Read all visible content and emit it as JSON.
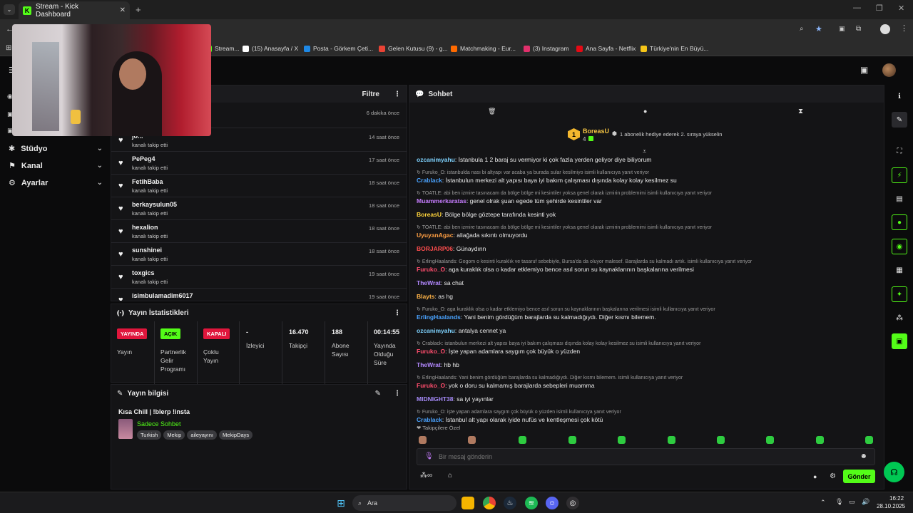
{
  "browser": {
    "tab_title": "Stream - Kick Dashboard",
    "new_tab": "+",
    "bookmarks": [
      {
        "label": "Stream...",
        "color": "#53fc18"
      },
      {
        "label": "(15) Anasayfa / X",
        "color": "#ffffff"
      },
      {
        "label": "Posta - Görkem Çeti...",
        "color": "#1e88e5"
      },
      {
        "label": "Gelen Kutusu (9) - g...",
        "color": "#ea4335"
      },
      {
        "label": "Matchmaking - Eur...",
        "color": "#ff6a00"
      },
      {
        "label": "(3) Instagram",
        "color": "#e1306c"
      },
      {
        "label": "Ana Sayfa - Netflix",
        "color": "#e50914"
      },
      {
        "label": "Türkiye'nin En Büyü...",
        "color": "#f5c518"
      }
    ]
  },
  "sidebar": {
    "items": [
      {
        "label": "Stüdyo",
        "icon": "studio-icon"
      },
      {
        "label": "Kanal",
        "icon": "channel-icon"
      },
      {
        "label": "Ayarlar",
        "icon": "gear-icon"
      }
    ]
  },
  "activity": {
    "filter_label": "Filtre",
    "first_time": "6 dakika önce",
    "rows": [
      {
        "name": "jo...",
        "sub": "kanalı takip etti",
        "time": "14 saat önce"
      },
      {
        "name": "PePeg4",
        "sub": "kanalı takip etti",
        "time": "17 saat önce"
      },
      {
        "name": "FetihBaba",
        "sub": "kanalı takip etti",
        "time": "18 saat önce"
      },
      {
        "name": "berkaysulun05",
        "sub": "kanalı takip etti",
        "time": "18 saat önce"
      },
      {
        "name": "hexalion",
        "sub": "kanalı takip etti",
        "time": "18 saat önce"
      },
      {
        "name": "sunshinei",
        "sub": "kanalı takip etti",
        "time": "18 saat önce"
      },
      {
        "name": "toxgics",
        "sub": "kanalı takip etti",
        "time": "19 saat önce"
      },
      {
        "name": "isimbulamadim6017",
        "sub": "",
        "time": "19 saat önce"
      }
    ]
  },
  "stats": {
    "title": "Yayın İstatistikleri",
    "cols": [
      {
        "badge": "YAYINDA",
        "badge_color": "#e0163c",
        "label": "Yayın"
      },
      {
        "badge": "AÇIK",
        "badge_color": "#53fc18",
        "label": "Partnerlik Gelir Programı"
      },
      {
        "badge": "KAPALI",
        "badge_color": "#e0163c",
        "label": "Çoklu Yayın"
      },
      {
        "value": "-",
        "label": "İzleyici"
      },
      {
        "value": "16.470",
        "label": "Takipçi"
      },
      {
        "value": "188",
        "label": "Abone Sayısı"
      },
      {
        "value": "00:14:55",
        "label": "Yayında Olduğu Süre"
      }
    ]
  },
  "info": {
    "title": "Yayın bilgisi",
    "stream_title": "Kısa Chill | !blerp !insta",
    "category": "Sadece Sohbet",
    "tags": [
      "Turkish",
      "Mekip",
      "aileyayını",
      "MekipDays"
    ]
  },
  "chat": {
    "title": "Sohbet",
    "top_user": "BoreasU",
    "top_rank": "1",
    "top_count": "4",
    "gift_text": "1 abonelik hediye ederek 2. sıraya yükselin",
    "followers_only": "Takipçilere Özel",
    "input_placeholder": "Bir mesaj gönderin",
    "send_label": "Gönder",
    "messages": [
      {
        "reply": "",
        "user": "ozcanimyahu",
        "color": "#7fd3ff",
        "text": ": İstanbula 1 2 baraj su vermiyor ki çok fazla yerden geliyor diye biliyorum"
      },
      {
        "reply": "Furuko_O: istanbulda nası bi altyapı var acaba ya burada sular kesilmiyo isimli kullanıcıya yanıt veriyor",
        "user": "Crablack",
        "color": "#4aa3ff",
        "text": ": İstanbulun merkezi alt yapısı baya iyi bakım çalışması dışında kolay kolay kesilmez su"
      },
      {
        "reply": "TOATLE: abi ben izmire tasınacam da bölge bölge mi kesintiler yoksa genel olarak izmirin problemimi isimli kullanıcıya yanıt veriyor",
        "user": "Muammerkaratas",
        "color": "#c77dff",
        "text": ": genel olrak şuan egede tüm şehirde kesintiler var"
      },
      {
        "reply": "",
        "user": "BoreasU",
        "color": "#ffd43b",
        "text": ": Bölge bölge göztepe tarafında kesinti yok"
      },
      {
        "reply": "TOATLE: abi ben izmire tasınacam da bölge bölge mi kesintiler yoksa genel olarak izmirin problemimi isimli kullanıcıya yanıt veriyor",
        "user": "UyuyanAgac",
        "color": "#ff9f43",
        "text": ": aliağada sıkıntı olmuyordu"
      },
      {
        "reply": "",
        "user": "BORJARP06",
        "color": "#ff4d4d",
        "text": ": Günaydınn"
      },
      {
        "reply": "ErlingHaalands: Gogom o kesinti kuraklık ve tasaruf sebebiyle, Bursa'da da oluyor malesef. Barajlarda su kalmadı artık. isimli kullanıcıya yanıt veriyor",
        "user": "Furuko_O",
        "color": "#ff4d6d",
        "text": ": aga kuraklık olsa o kadar etklemiyo bence asıl sorun su kaynaklarının başkalarına verilmesi"
      },
      {
        "reply": "",
        "user": "TheWrat",
        "color": "#b388ff",
        "text": ": sa chat"
      },
      {
        "reply": "",
        "user": "Blayts",
        "color": "#ffb347",
        "text": ": as hg"
      },
      {
        "reply": "Furuko_O: aga kuraklık olsa o kadar etklemiyo bence asıl sorun su kaynaklarının başkalarına verilmesi isimli kullanıcıya yanıt veriyor",
        "user": "ErlingHaalands",
        "color": "#4aa3ff",
        "text": ": Yani benim gördüğüm barajlarda su kalmadığıydı. Diğer kısmı bilemem."
      },
      {
        "reply": "",
        "user": "ozcanimyahu",
        "color": "#7fd3ff",
        "text": ": antalya cennet ya"
      },
      {
        "reply": "Crablack: istanbulun merkezi alt yapısı baya iyi bakım çalışması dışında kolay kolay kesilmez su isimli kullanıcıya yanıt veriyor",
        "user": "Furuko_O",
        "color": "#ff4d6d",
        "text": ": İşte yapan adamlara saygım çok büyük o yüzden"
      },
      {
        "reply": "",
        "user": "TheWrat",
        "color": "#b388ff",
        "text": ": hb hb"
      },
      {
        "reply": "ErlingHaalands: Yani benim gördüğüm barajlarda su kalmadığıydı. Diğer kısmı bilemem. isimli kullanıcıya yanıt veriyor",
        "user": "Furuko_O",
        "color": "#ff4d6d",
        "text": ": yok o doru su kalmamış barajlarda sebepleri muamma"
      },
      {
        "reply": "",
        "user": "MIDNIGHT38",
        "color": "#a78bfa",
        "text": ": sa iyi yayınlar"
      },
      {
        "reply": "Furuko_O: işte yapan adamlara saygım çok büyük o yüzden isimli kullanıcıya yanıt veriyor",
        "user": "Crablack",
        "color": "#4aa3ff",
        "text": ": İstanbul alt yapı olarak iyide nufüs ve kentleşmesi çok kötü"
      }
    ]
  },
  "taskbar": {
    "search": "Ara",
    "time": "16:22",
    "date": "28.10.2025"
  },
  "colors": {
    "accent": "#53fc18",
    "live": "#e0163c"
  }
}
